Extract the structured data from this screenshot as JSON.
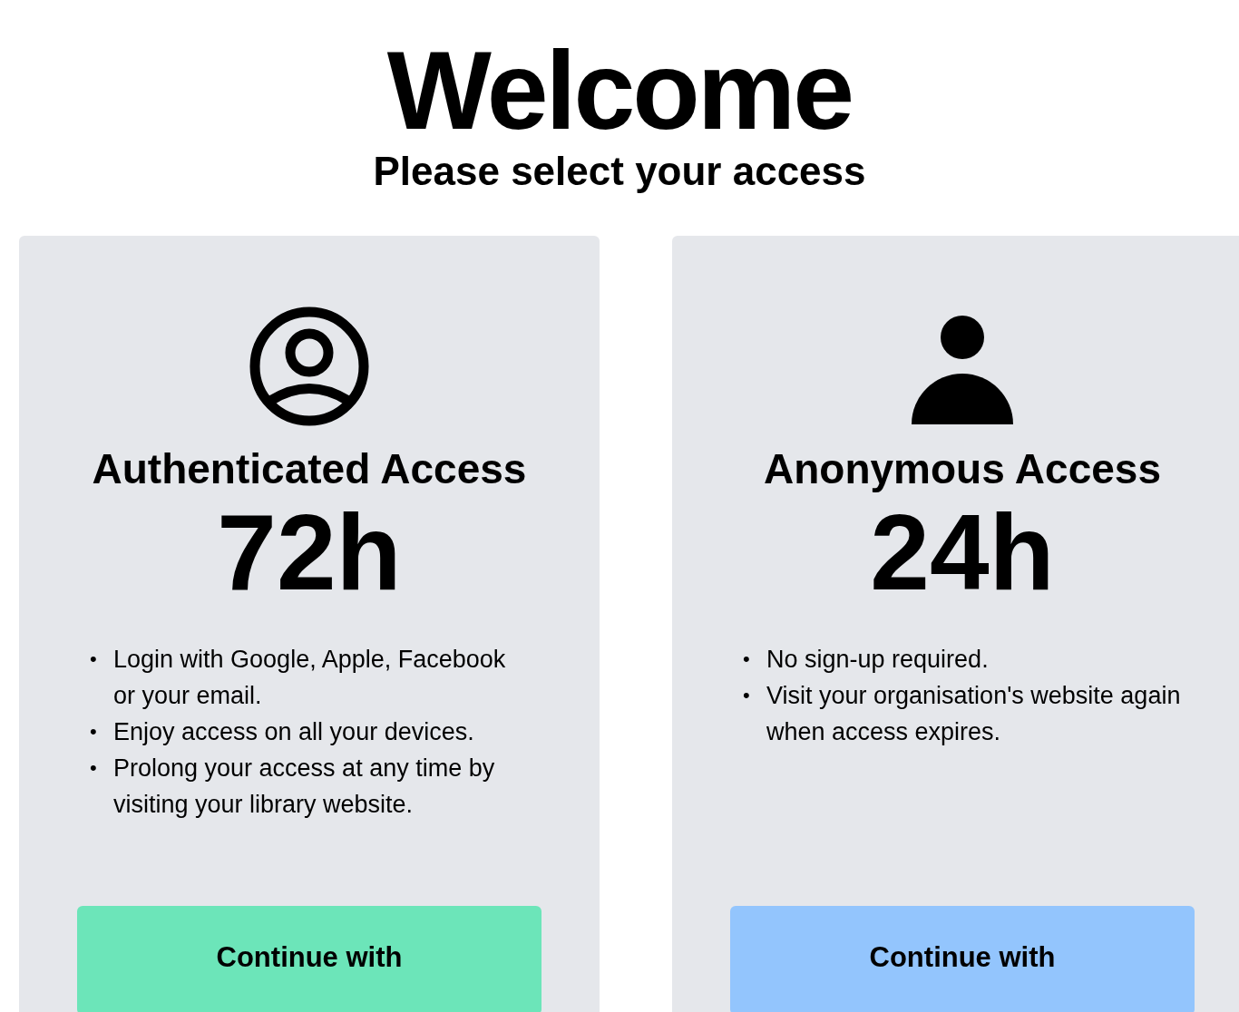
{
  "heading": "Welcome",
  "subheading": "Please select your access",
  "options": [
    {
      "kind": "outline-user",
      "marker": "•",
      "title": "Authenticated Access",
      "duration": "72h",
      "color": "#6ce5b9",
      "points": [
        "Login with Google, Apple, Facebook or your email.",
        "Enjoy access on all your devices.",
        "Prolong your access at any time by visiting your library website."
      ],
      "button": "Continue with"
    },
    {
      "kind": "filled-user",
      "marker": "•",
      "title": "Anonymous Access",
      "duration": "24h",
      "color": "#93c5fd",
      "points": [
        "No sign-up required.",
        "Visit your organisation's website again when access expires."
      ],
      "button": "Continue with"
    }
  ]
}
